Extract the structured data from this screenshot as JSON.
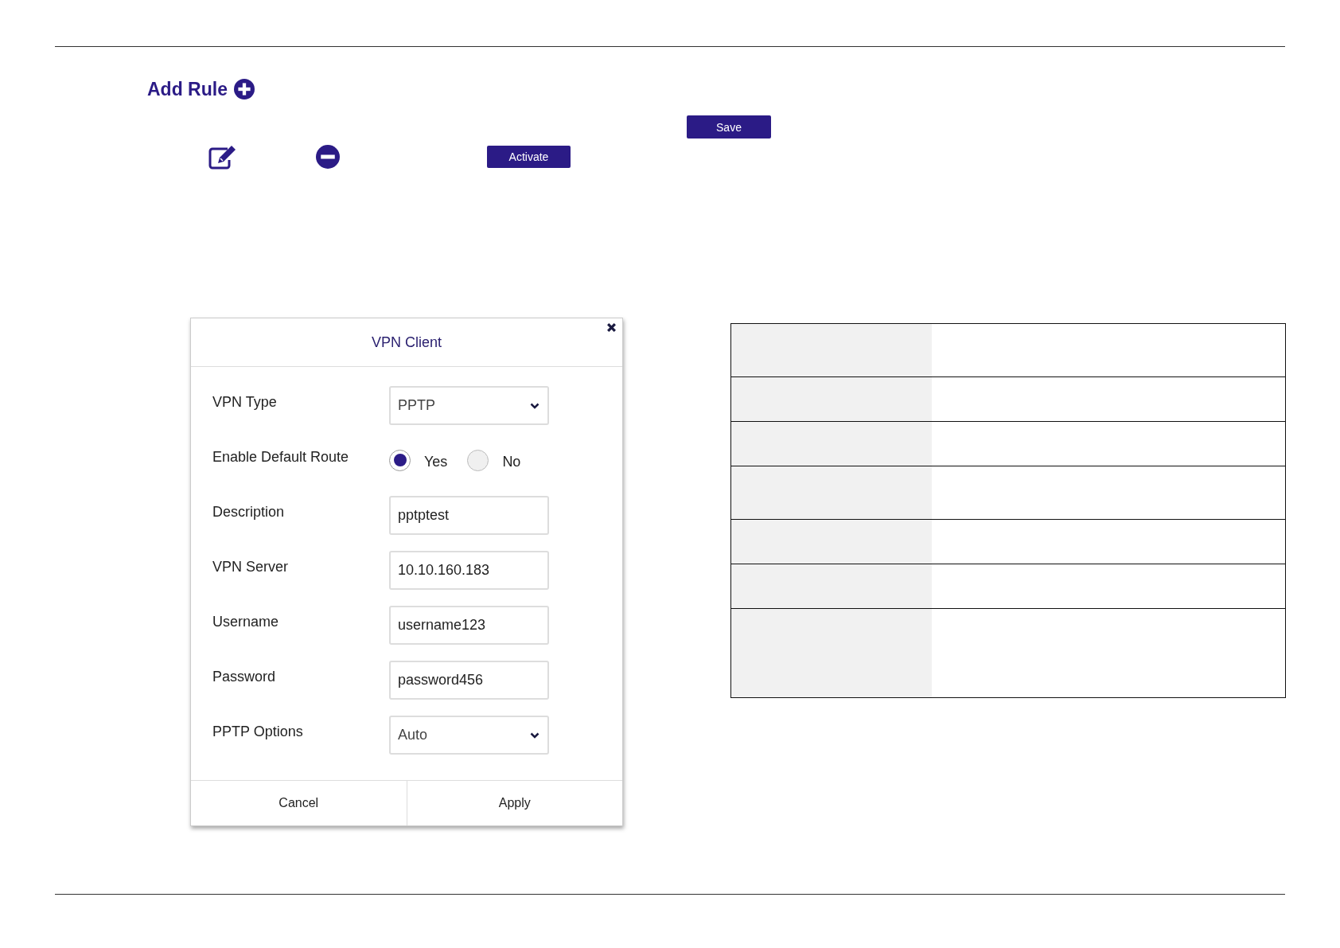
{
  "page": {
    "title": "Add Rule",
    "save_button": "Save",
    "activate_button": "Activate"
  },
  "dialog": {
    "title": "VPN Client",
    "fields": [
      {
        "kind": "select",
        "label": "VPN Type",
        "value": "PPTP"
      },
      {
        "kind": "radio",
        "label": "Enable Default Route",
        "options": [
          {
            "label": "Yes",
            "selected": true
          },
          {
            "label": "No",
            "selected": false
          }
        ]
      },
      {
        "kind": "text",
        "label": "Description",
        "value": "pptptest"
      },
      {
        "kind": "text",
        "label": "VPN Server",
        "value": "10.10.160.183"
      },
      {
        "kind": "text",
        "label": "Username",
        "value": "username123"
      },
      {
        "kind": "text",
        "label": "Password",
        "value": "password456"
      },
      {
        "kind": "select",
        "label": "PPTP Options",
        "value": "Auto"
      }
    ],
    "buttons": [
      "Cancel",
      "Apply"
    ]
  }
}
